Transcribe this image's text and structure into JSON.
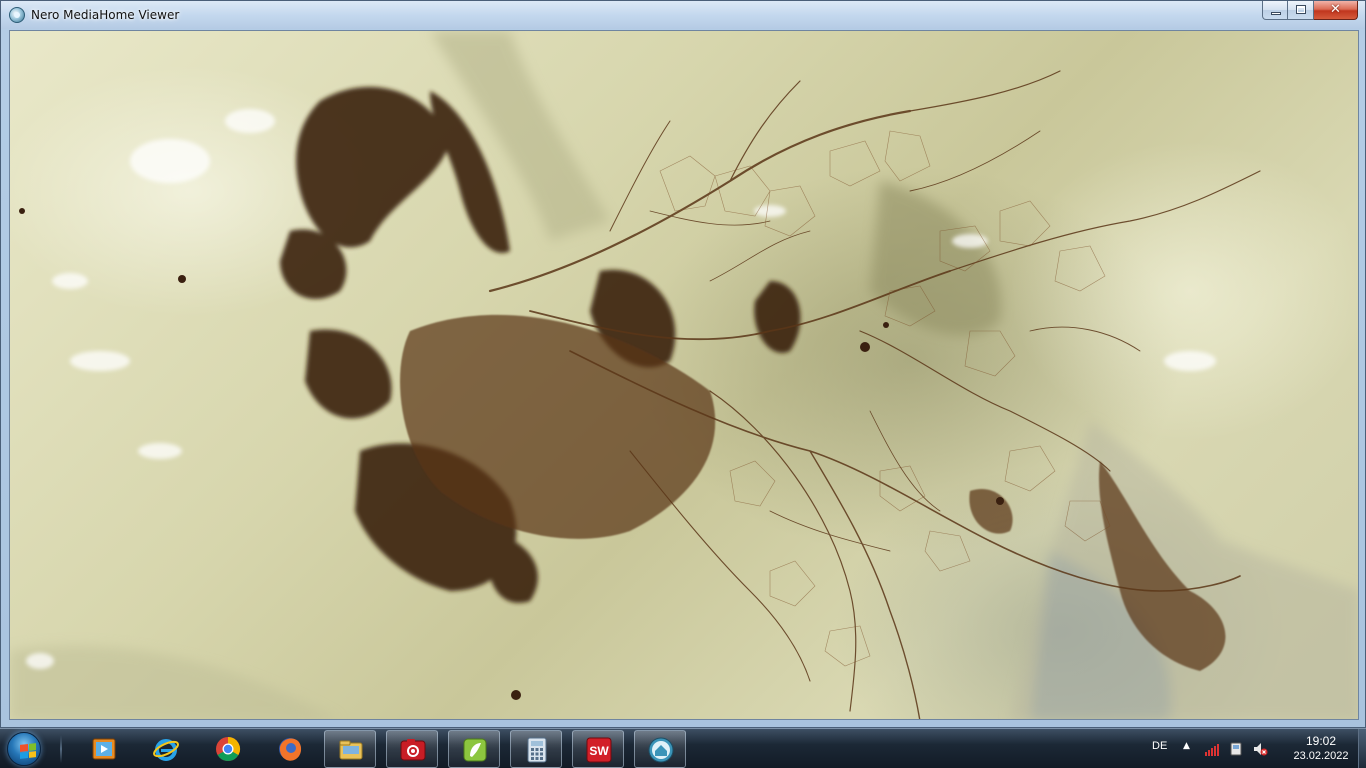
{
  "window": {
    "title": "Nero MediaHome Viewer",
    "close_glyph": "✕",
    "icon": "nero-mediahome-icon"
  },
  "photo": {
    "subject": "brown branching network on pale yellow agar-like surface",
    "background_color": "#d7d6ad",
    "network_color": "#4a2a14"
  },
  "taskbar": {
    "start": {
      "icon": "windows-start-orb-icon"
    },
    "pinned": [
      {
        "name": "media-player-icon",
        "active": false
      },
      {
        "name": "internet-explorer-icon",
        "active": false
      },
      {
        "name": "chrome-icon",
        "active": false
      },
      {
        "name": "firefox-icon",
        "active": false
      },
      {
        "name": "file-explorer-icon",
        "active": true
      },
      {
        "name": "camera-app-icon",
        "active": true
      },
      {
        "name": "green-app-icon",
        "active": true
      },
      {
        "name": "calculator-icon",
        "active": true
      },
      {
        "name": "solidworks-icon",
        "active": true
      },
      {
        "name": "nero-mediahome-icon",
        "active": true
      }
    ],
    "tray": {
      "language": "DE",
      "overflow_arrow": "▲",
      "icons": [
        "network-signal-icon",
        "device-icon",
        "volume-muted-icon"
      ],
      "time": "19:02",
      "date": "23.02.2022"
    }
  }
}
